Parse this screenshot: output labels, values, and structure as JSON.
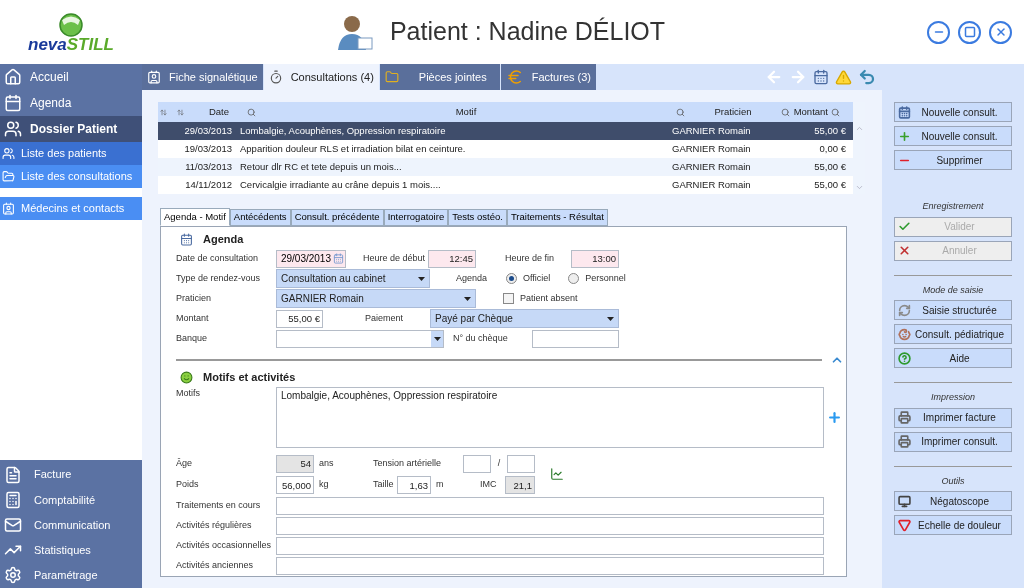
{
  "header": {
    "logo": {
      "part_1": "neva",
      "part_2": "STILL"
    },
    "title": "Patient : Nadine DÉLIOT"
  },
  "sidebar": {
    "items": [
      {
        "label": "Accueil",
        "kind": "main",
        "selected": false
      },
      {
        "label": "Agenda",
        "kind": "main",
        "selected": false
      },
      {
        "label": "Dossier Patient",
        "kind": "main",
        "selected": true
      },
      {
        "label": "Liste des patients",
        "kind": "sub",
        "selected": true
      },
      {
        "label": "Liste des consultations",
        "kind": "sub",
        "selected": false
      },
      {
        "label": "Médecins et contacts",
        "kind": "link",
        "selected": false
      }
    ],
    "bottom_items": [
      {
        "label": "Facture"
      },
      {
        "label": "Comptabilité"
      },
      {
        "label": "Communication"
      },
      {
        "label": "Statistiques"
      },
      {
        "label": "Paramétrage"
      }
    ]
  },
  "tabs": [
    {
      "label": "Fiche signalétique",
      "selected": false
    },
    {
      "label": "Consultations (4)",
      "selected": true
    },
    {
      "label": "Pièces jointes",
      "selected": false
    },
    {
      "label": "Factures (3)",
      "selected": false
    }
  ],
  "table": {
    "columns": [
      "Date",
      "Motif",
      "Praticien",
      "Montant"
    ],
    "rows": [
      {
        "date": "29/03/2013",
        "motif": "Lombalgie, Acouphènes, Oppression respiratoire",
        "praticien": "GARNIER Romain",
        "montant": "55,00 €",
        "selected": true
      },
      {
        "date": "19/03/2013",
        "motif": "Apparition douleur RLS et irradiation bilat en ceinture.",
        "praticien": "GARNIER Romain",
        "montant": "0,00 €",
        "selected": false
      },
      {
        "date": "11/03/2013",
        "motif": "Retour dlr RC et tete depuis un mois...",
        "praticien": "GARNIER Romain",
        "montant": "55,00 €",
        "selected": false
      },
      {
        "date": "14/11/2012",
        "motif": "Cervicalgie irradiante au crâne depuis 1 mois....",
        "praticien": "GARNIER Romain",
        "montant": "55,00 €",
        "selected": false
      }
    ]
  },
  "subtabs": [
    {
      "label": "Agenda - Motif",
      "selected": true
    },
    {
      "label": "Antécédents",
      "selected": false
    },
    {
      "label": "Consult. précédente",
      "selected": false
    },
    {
      "label": "Interrogatoire",
      "selected": false
    },
    {
      "label": "Tests ostéo.",
      "selected": false
    },
    {
      "label": "Traitements - Résultat",
      "selected": false
    }
  ],
  "agenda": {
    "heading": "Agenda",
    "date_label": "Date de consultation",
    "date": "29/03/2013",
    "start_label": "Heure de début",
    "start": "12:45",
    "end_label": "Heure de fin",
    "end": "13:00",
    "type_label": "Type de rendez-vous",
    "type": "Consultation au cabinet",
    "agenda_label": "Agenda",
    "agenda_options": [
      {
        "label": "Officiel",
        "selected": true
      },
      {
        "label": "Personnel",
        "selected": false
      }
    ],
    "praticien_label": "Praticien",
    "praticien": "GARNIER Romain",
    "absent_label": "Patient absent",
    "absent_checked": false,
    "montant_label": "Montant",
    "montant": "55,00 €",
    "paiement_label": "Paiement",
    "paiement": "Payé par Chèque",
    "banque_label": "Banque",
    "cheque_label": "N° du chèque"
  },
  "motifs": {
    "heading": "Motifs et activités",
    "motifs_label": "Motifs",
    "motifs": "Lombalgie, Acouphènes, Oppression respiratoire",
    "age_label": "Âge",
    "age": "54",
    "age_unit": "ans",
    "tension_label": "Tension artérielle",
    "tension_sep": "/",
    "poids_label": "Poids",
    "poids": "56,000",
    "poids_unit": "kg",
    "taille_label": "Taille",
    "taille": "1,63",
    "taille_unit": "m",
    "imc_label": "IMC",
    "imc": "21,1",
    "activities": [
      "Traitements en cours",
      "Activités régulières",
      "Activités occasionnelles",
      "Activités anciennes"
    ]
  },
  "right_panel": {
    "groups": [
      {
        "buttons": [
          {
            "label": "Nouvelle consult.",
            "disabled": false
          },
          {
            "label": "Nouvelle consult.",
            "disabled": false
          },
          {
            "label": "Supprimer",
            "disabled": false
          }
        ]
      },
      {
        "title": "Enregistrement",
        "buttons": [
          {
            "label": "Valider",
            "disabled": true
          },
          {
            "label": "Annuler",
            "disabled": true
          }
        ]
      },
      {
        "title": "Mode de saisie",
        "buttons": [
          {
            "label": "Saisie structurée",
            "disabled": false
          },
          {
            "label": "Consult. pédiatrique",
            "disabled": false
          },
          {
            "label": "Aide",
            "disabled": false
          }
        ]
      },
      {
        "title": "Impression",
        "buttons": [
          {
            "label": "Imprimer facture",
            "disabled": false
          },
          {
            "label": "Imprimer consult.",
            "disabled": false
          }
        ]
      },
      {
        "title": "Outils",
        "buttons": [
          {
            "label": "Négatoscope",
            "disabled": false
          },
          {
            "label": "Echelle de douleur",
            "disabled": false
          }
        ]
      }
    ]
  }
}
